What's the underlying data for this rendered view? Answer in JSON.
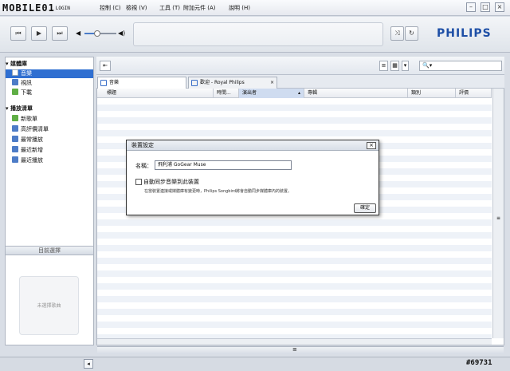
{
  "menubar": {
    "logo_text": "MOBILE01",
    "logo_sub": "LOGIN",
    "items": [
      "控制 (C)",
      "檢視 (V)",
      "工具 (T)",
      "附加元件 (A)",
      "說明 (H)"
    ],
    "window_buttons": [
      "–",
      "□",
      "×"
    ]
  },
  "toolbar": {
    "prev_icon": "previous-icon",
    "play_icon": "play-icon",
    "next_icon": "next-icon",
    "volume_level": 0.4,
    "brand": "PHILIPS"
  },
  "sidebar": {
    "library_header": "媒體庫",
    "library_items": [
      {
        "label": "音樂",
        "icon": "music-icon",
        "selected": true
      },
      {
        "label": "視訊",
        "icon": "video-icon",
        "selected": false
      },
      {
        "label": "下載",
        "icon": "download-icon",
        "selected": false
      }
    ],
    "playlist_header": "播放清單",
    "playlist_items": [
      {
        "label": "新歌單",
        "icon": "add-playlist-icon"
      },
      {
        "label": "高評價清單",
        "icon": "playlist-icon"
      },
      {
        "label": "最常播放",
        "icon": "playlist-icon"
      },
      {
        "label": "最近新增",
        "icon": "playlist-icon"
      },
      {
        "label": "最近播放",
        "icon": "playlist-icon"
      }
    ],
    "current_selection_label": "目前選擇",
    "no_selection_text": "未選擇歌曲"
  },
  "main": {
    "tabs": [
      {
        "label": "音樂",
        "active": true
      },
      {
        "label": "歡迎 - Royal Philips",
        "active": false
      }
    ],
    "columns": [
      "標題",
      "時間...",
      "演出者",
      "專輯",
      "類別",
      "評價"
    ]
  },
  "dialog": {
    "title": "裝置設定",
    "name_label": "名稱：",
    "name_value": "飛利浦 GoGear Muse",
    "checkbox_label": "自動同步音樂到此裝置",
    "description": "在當裝置連接或媒體庫有變更時，Philips Songbird將會自動同步媒體庫內的裝置。",
    "ok_label": "確定"
  },
  "watermark": "#69731"
}
